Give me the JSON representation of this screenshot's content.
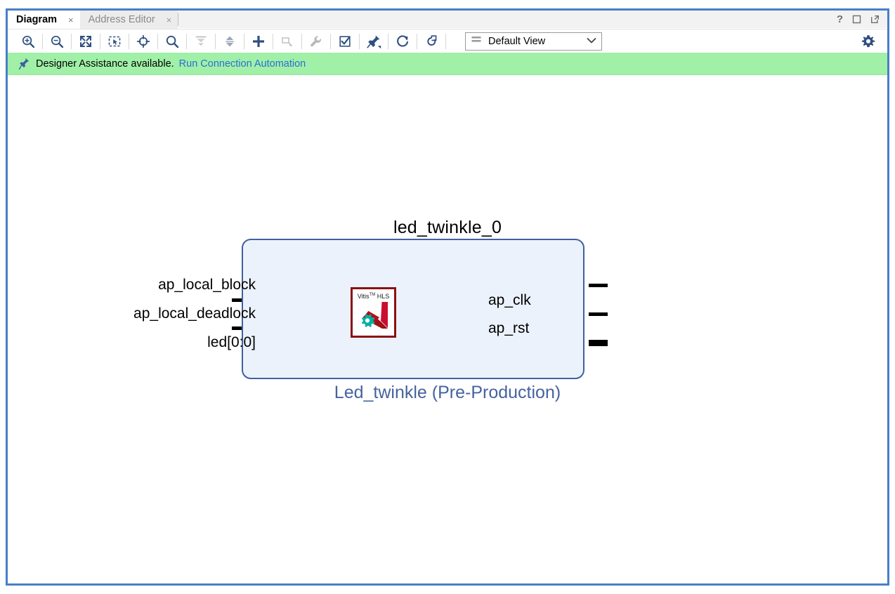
{
  "window": {
    "controls": [
      {
        "name": "help-button",
        "glyph": "?"
      },
      {
        "name": "maximize-button",
        "glyph": "maximize-icon"
      },
      {
        "name": "float-button",
        "glyph": "float-icon"
      }
    ]
  },
  "tabs": [
    {
      "label": "Diagram",
      "active": true,
      "close": "×"
    },
    {
      "label": "Address Editor",
      "active": false,
      "close": "×"
    }
  ],
  "toolbar": {
    "buttons": [
      {
        "name": "zoom-in-icon",
        "title": "Zoom In",
        "enabled": true
      },
      {
        "name": "zoom-out-icon",
        "title": "Zoom Out",
        "enabled": true
      },
      {
        "name": "zoom-fit-icon",
        "title": "Zoom Fit",
        "enabled": true
      },
      {
        "name": "zoom-area-icon",
        "title": "Zoom Area",
        "enabled": true
      },
      {
        "name": "fit-selection-icon",
        "title": "Fit Selection",
        "enabled": true
      },
      {
        "name": "search-icon",
        "title": "Search",
        "enabled": true
      },
      {
        "name": "align-vertical-icon",
        "title": "Optimize Routing",
        "enabled": false
      },
      {
        "name": "expand-collapse-icon",
        "title": "Expand All",
        "enabled": true
      },
      {
        "name": "add-ip-icon",
        "title": "Add IP",
        "enabled": true
      },
      {
        "name": "add-module-icon",
        "title": "Add Module",
        "enabled": false
      },
      {
        "name": "wrench-icon",
        "title": "Customize Block",
        "enabled": false
      },
      {
        "name": "validate-icon",
        "title": "Validate Design",
        "enabled": true
      },
      {
        "name": "pin-icon",
        "title": "Pin",
        "enabled": true
      },
      {
        "name": "refresh-icon",
        "title": "Regenerate Layout",
        "enabled": true
      },
      {
        "name": "timer-icon",
        "title": "Run Block Automation",
        "enabled": true
      }
    ],
    "view_select": {
      "label": "Default View",
      "options": [
        "Default View"
      ]
    },
    "settings": {
      "name": "gear-icon",
      "title": "Settings"
    }
  },
  "banner": {
    "icon": "pushpin-icon",
    "message": "Designer Assistance available.",
    "link": "Run Connection Automation",
    "background": "#a0f0a8",
    "link_color": "#2a6fd4"
  },
  "diagram": {
    "block": {
      "instance_name": "led_twinkle_0",
      "ip_name": "Led_twinkle (Pre-Production)",
      "border_color": "#41619e",
      "fill_color": "#ebf2fc",
      "subtitle_color": "#46639e",
      "logo": {
        "name": "vitis-hls-logo",
        "text_primary": "Vitis",
        "text_tm": "TM",
        "text_secondary": "HLS",
        "border_color": "#8d1013"
      },
      "input_ports": [
        {
          "label": "ap_clk",
          "type": "single"
        },
        {
          "label": "ap_rst",
          "type": "single"
        }
      ],
      "output_ports": [
        {
          "label": "ap_local_block",
          "type": "single"
        },
        {
          "label": "ap_local_deadlock",
          "type": "single"
        },
        {
          "label": "led[0:0]",
          "type": "bus"
        }
      ]
    }
  }
}
